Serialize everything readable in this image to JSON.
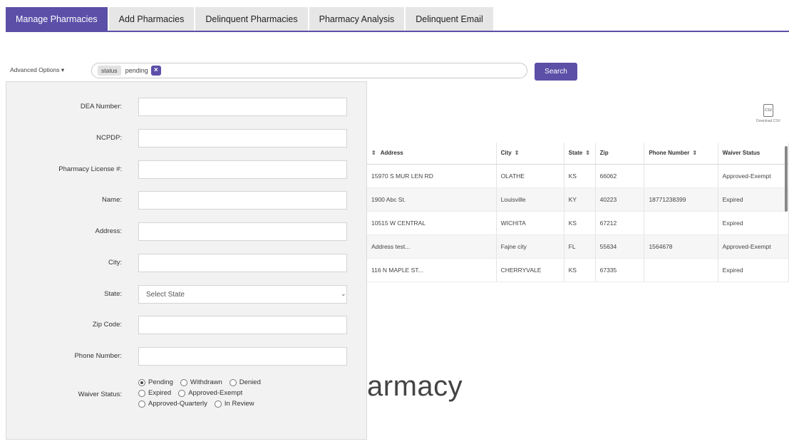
{
  "tabs": [
    {
      "label": "Manage Pharmacies",
      "active": true
    },
    {
      "label": "Add Pharmacies"
    },
    {
      "label": "Delinquent Pharmacies"
    },
    {
      "label": "Pharmacy Analysis"
    },
    {
      "label": "Delinquent Email"
    }
  ],
  "search": {
    "advanced_label": "Advanced Options",
    "advanced_caret": "▾",
    "chip_field": "status",
    "chip_value": "pending",
    "chip_remove": "×",
    "button_label": "Search"
  },
  "download": {
    "icon_text": "CSV",
    "label": "Download CSV"
  },
  "form": {
    "dea_label": "DEA Number:",
    "ncpdp_label": "NCPDP:",
    "license_label": "Pharmacy License #:",
    "name_label": "Name:",
    "address_label": "Address:",
    "city_label": "City:",
    "state_label": "State:",
    "state_selected": "Select State",
    "zip_label": "Zip Code:",
    "phone_label": "Phone Number:",
    "waiver_label": "Waiver Status:",
    "waiver_options": [
      "Pending",
      "Withdrawn",
      "Denied",
      "Expired",
      "Approved-Exempt",
      "Approved-Quarterly",
      "In Review"
    ],
    "waiver_selected": "Pending"
  },
  "table": {
    "sort_icon": "⇕",
    "columns": [
      "Address",
      "City",
      "State",
      "Zip",
      "Phone Number",
      "Waiver Status"
    ],
    "rows": [
      [
        "15970 S MUR LEN RD",
        "OLATHE",
        "KS",
        "66062",
        "",
        "Approved-Exempt"
      ],
      [
        "1900 Abc St.",
        "Louisville",
        "KY",
        "40223",
        "18771238399",
        "Expired"
      ],
      [
        "10515 W CENTRAL",
        "WICHITA",
        "KS",
        "67212",
        "",
        "Expired"
      ],
      [
        "Address test...",
        "Fajne city",
        "FL",
        "55634",
        "1564678",
        "Approved-Exempt"
      ],
      [
        "116 N MAPLE ST...",
        "CHERRYVALE",
        "KS",
        "67335",
        "",
        "Expired"
      ]
    ]
  },
  "page_title_partial": "armacy",
  "colors": {
    "accent": "#5b4fa8",
    "tab_inactive": "#e6e6e6",
    "panel_bg": "#f2f2f2"
  }
}
